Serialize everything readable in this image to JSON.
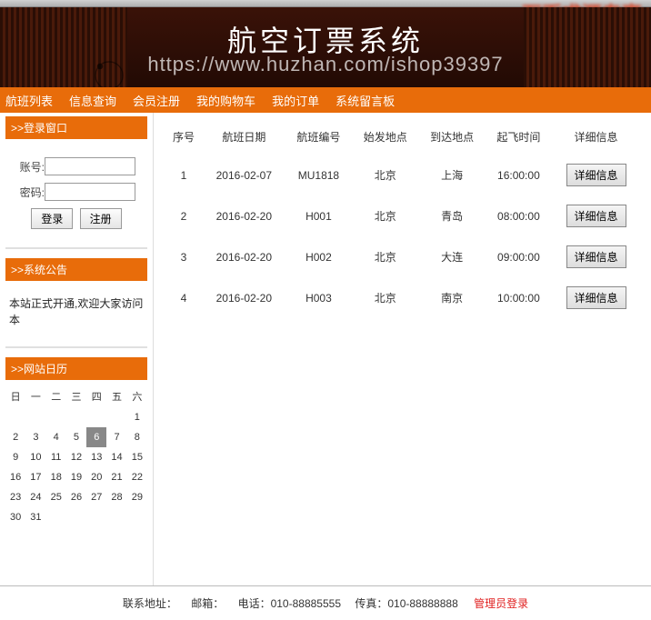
{
  "banner": {
    "title": "航空订票系统",
    "watermark": "https://www.huzhan.com/ishop39397",
    "faded_text": "万币求源专享"
  },
  "nav": {
    "items": [
      {
        "label": "航班列表"
      },
      {
        "label": "信息查询"
      },
      {
        "label": "会员注册"
      },
      {
        "label": "我的购物车"
      },
      {
        "label": "我的订单"
      },
      {
        "label": "系统留言板"
      }
    ]
  },
  "sidebar": {
    "login": {
      "title": ">>登录窗口",
      "user_label": "账号:",
      "pass_label": "密码:",
      "login_btn": "登录",
      "reg_btn": "注册"
    },
    "notice": {
      "title": ">>系统公告",
      "text": "本站正式开通,欢迎大家访问本"
    },
    "calendar": {
      "title": ">>网站日历",
      "weekdays": [
        "日",
        "一",
        "二",
        "三",
        "四",
        "五",
        "六"
      ],
      "rows": [
        [
          "",
          "",
          "",
          "",
          "",
          "",
          "1"
        ],
        [
          "2",
          "3",
          "4",
          "5",
          "6",
          "7",
          "8"
        ],
        [
          "9",
          "10",
          "11",
          "12",
          "13",
          "14",
          "15"
        ],
        [
          "16",
          "17",
          "18",
          "19",
          "20",
          "21",
          "22"
        ],
        [
          "23",
          "24",
          "25",
          "26",
          "27",
          "28",
          "29"
        ],
        [
          "30",
          "31",
          "",
          "",
          "",
          "",
          ""
        ]
      ],
      "current": "6"
    }
  },
  "table": {
    "headers": [
      "序号",
      "航班日期",
      "航班编号",
      "始发地点",
      "到达地点",
      "起飞时间",
      "详细信息"
    ],
    "detail_btn": "详细信息",
    "rows": [
      {
        "seq": "1",
        "date": "2016-02-07",
        "code": "MU1818",
        "from": "北京",
        "to": "上海",
        "time": "16:00:00"
      },
      {
        "seq": "2",
        "date": "2016-02-20",
        "code": "H001",
        "from": "北京",
        "to": "青岛",
        "time": "08:00:00"
      },
      {
        "seq": "3",
        "date": "2016-02-20",
        "code": "H002",
        "from": "北京",
        "to": "大连",
        "time": "09:00:00"
      },
      {
        "seq": "4",
        "date": "2016-02-20",
        "code": "H003",
        "from": "北京",
        "to": "南京",
        "time": "10:00:00"
      }
    ]
  },
  "footer": {
    "contact_label": "联系地址：",
    "email_label": "邮箱：",
    "phone_label": "电话：010-88885555",
    "fax_label": "传真：010-88888888",
    "admin_link": "管理员登录"
  }
}
